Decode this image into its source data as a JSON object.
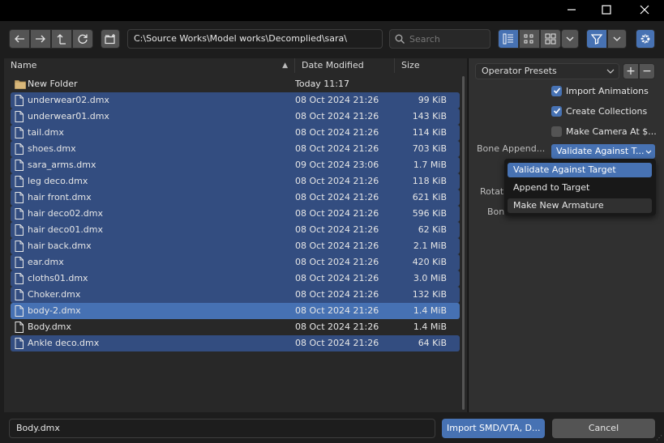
{
  "window": {
    "minimize_label": "—",
    "maximize_label": "☐",
    "close_label": "✕"
  },
  "toolbar": {
    "path": "C:\\Source Works\\Model works\\Decomplied\\sara\\",
    "search_placeholder": "Search",
    "accent": "#4772b3"
  },
  "filelist": {
    "columns": {
      "name": "Name",
      "date": "Date Modified",
      "size": "Size"
    },
    "rows": [
      {
        "name": "New Folder",
        "date": "Today 11:17",
        "size": "",
        "type": "folder",
        "selected": false
      },
      {
        "name": "underwear02.dmx",
        "date": "08 Oct 2024 21:26",
        "size": "99 KiB",
        "type": "file",
        "selected": true
      },
      {
        "name": "underwear01.dmx",
        "date": "08 Oct 2024 21:26",
        "size": "143 KiB",
        "type": "file",
        "selected": true
      },
      {
        "name": "tail.dmx",
        "date": "08 Oct 2024 21:26",
        "size": "114 KiB",
        "type": "file",
        "selected": true
      },
      {
        "name": "shoes.dmx",
        "date": "08 Oct 2024 21:26",
        "size": "703 KiB",
        "type": "file",
        "selected": true
      },
      {
        "name": "sara_arms.dmx",
        "date": "09 Oct 2024 23:06",
        "size": "1.7 MiB",
        "type": "file",
        "selected": true
      },
      {
        "name": "leg deco.dmx",
        "date": "08 Oct 2024 21:26",
        "size": "118 KiB",
        "type": "file",
        "selected": true
      },
      {
        "name": "hair front.dmx",
        "date": "08 Oct 2024 21:26",
        "size": "621 KiB",
        "type": "file",
        "selected": true
      },
      {
        "name": "hair deco02.dmx",
        "date": "08 Oct 2024 21:26",
        "size": "596 KiB",
        "type": "file",
        "selected": true
      },
      {
        "name": "hair deco01.dmx",
        "date": "08 Oct 2024 21:26",
        "size": "62 KiB",
        "type": "file",
        "selected": true
      },
      {
        "name": "hair back.dmx",
        "date": "08 Oct 2024 21:26",
        "size": "2.1 MiB",
        "type": "file",
        "selected": true
      },
      {
        "name": "ear.dmx",
        "date": "08 Oct 2024 21:26",
        "size": "420 KiB",
        "type": "file",
        "selected": true
      },
      {
        "name": "cloths01.dmx",
        "date": "08 Oct 2024 21:26",
        "size": "3.0 MiB",
        "type": "file",
        "selected": true
      },
      {
        "name": "Choker.dmx",
        "date": "08 Oct 2024 21:26",
        "size": "132 KiB",
        "type": "file",
        "selected": true
      },
      {
        "name": "body-2.dmx",
        "date": "08 Oct 2024 21:26",
        "size": "1.4 MiB",
        "type": "file",
        "selected": true,
        "highlight": true
      },
      {
        "name": "Body.dmx",
        "date": "08 Oct 2024 21:26",
        "size": "1.4 MiB",
        "type": "file",
        "selected": false
      },
      {
        "name": "Ankle deco.dmx",
        "date": "08 Oct 2024 21:26",
        "size": "64 KiB",
        "type": "file",
        "selected": true
      }
    ]
  },
  "side": {
    "presets_label": "Operator Presets",
    "plus_label": "+",
    "minus_label": "−",
    "import_animations": "Import Animations",
    "create_collections": "Create Collections",
    "make_camera": "Make Camera At $...",
    "bone_append_label": "Bone Append...",
    "bone_append_value": "Validate Against T...",
    "rotation_label_partial": "Rotati",
    "bone_label_partial": "Bon"
  },
  "dropdown": {
    "options": [
      "Validate Against Target",
      "Append to Target",
      "Make New Armature"
    ]
  },
  "bottom": {
    "filename": "Body.dmx",
    "import_label": "Import SMD/VTA, D...",
    "cancel_label": "Cancel"
  }
}
